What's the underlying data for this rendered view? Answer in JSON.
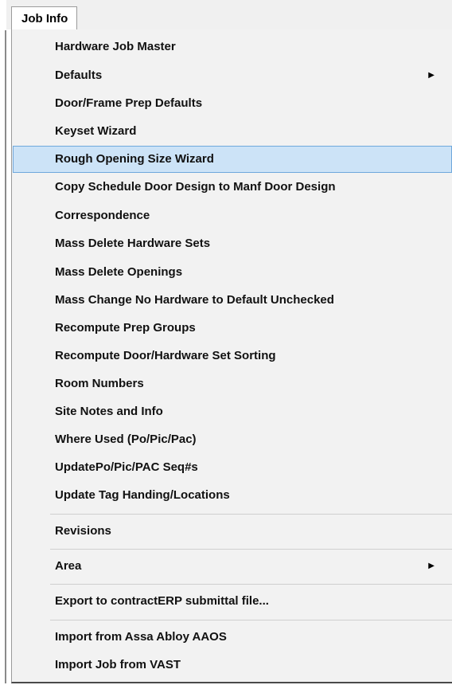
{
  "menubar": {
    "active_menu": "Job Info"
  },
  "menu": {
    "group1": [
      {
        "label": "Hardware Job Master"
      },
      {
        "label": "Defaults",
        "submenu": true
      },
      {
        "label": "Door/Frame Prep Defaults"
      },
      {
        "label": "Keyset Wizard"
      },
      {
        "label": "Rough Opening Size Wizard",
        "highlighted": true
      },
      {
        "label": "Copy Schedule Door Design to Manf Door Design"
      },
      {
        "label": "Correspondence"
      },
      {
        "label": "Mass Delete Hardware Sets"
      },
      {
        "label": "Mass Delete Openings"
      },
      {
        "label": "Mass Change No Hardware to Default Unchecked"
      },
      {
        "label": "Recompute Prep Groups"
      },
      {
        "label": "Recompute Door/Hardware Set Sorting"
      },
      {
        "label": "Room Numbers"
      },
      {
        "label": "Site Notes and Info"
      },
      {
        "label": "Where Used (Po/Pic/Pac)"
      },
      {
        "label": "UpdatePo/Pic/PAC Seq#s"
      },
      {
        "label": "Update Tag Handing/Locations"
      }
    ],
    "group2": [
      {
        "label": "Revisions"
      }
    ],
    "group3": [
      {
        "label": "Area",
        "submenu": true
      }
    ],
    "group4": [
      {
        "label": "Export to contractERP submittal file..."
      }
    ],
    "group5": [
      {
        "label": "Import from Assa Abloy AAOS"
      },
      {
        "label": "Import Job from VAST"
      }
    ],
    "submenu_glyph": "▶",
    "highlight_color": "#cce3f7",
    "highlight_border": "#6fa8dc"
  }
}
